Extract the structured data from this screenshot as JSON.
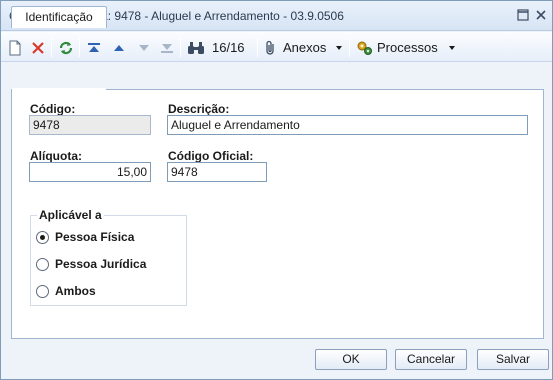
{
  "window": {
    "title": "Código da Receita: 9478 - Aluguel e Arrendamento - 03.9.0506"
  },
  "toolbar": {
    "record_counter": "16/16",
    "attachments_label": "Anexos",
    "processes_label": "Processos"
  },
  "tabs": [
    {
      "label": "Identificação"
    }
  ],
  "form": {
    "codigo_label": "Código:",
    "codigo_value": "9478",
    "descricao_label": "Descrição:",
    "descricao_value": "Aluguel e Arrendamento",
    "aliquota_label": "Alíquota:",
    "aliquota_value": "15,00",
    "codigo_oficial_label": "Código Oficial:",
    "codigo_oficial_value": "9478"
  },
  "aplicavel": {
    "title": "Aplicável a",
    "options": [
      {
        "label": "Pessoa Física",
        "checked": true
      },
      {
        "label": "Pessoa Jurídica",
        "checked": false
      },
      {
        "label": "Ambos",
        "checked": false
      }
    ]
  },
  "footer": {
    "ok_label": "OK",
    "cancel_label": "Cancelar",
    "save_label": "Salvar"
  },
  "colors": {
    "accent": "#2f62b3",
    "delete": "#d93a2b",
    "refresh": "#2e8b3c"
  }
}
